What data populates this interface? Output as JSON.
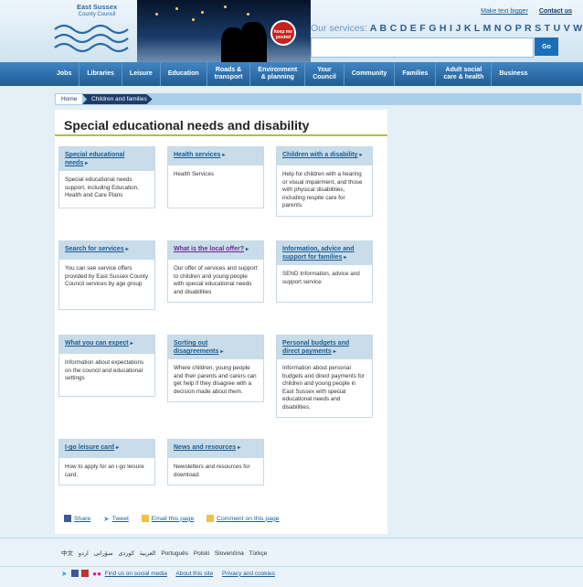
{
  "header": {
    "logo_line1": "East Sussex",
    "logo_line2": "County Council",
    "banner_sign": "keep me posted",
    "text_blogger": "Make text bigger",
    "contact": "Contact us",
    "services_label": "Our services:",
    "services_letters": "A B C D E F G H I J K L M N O P R S T U V W Y Z",
    "search_placeholder": "",
    "go": "Go"
  },
  "nav": [
    "Jobs",
    "Libraries",
    "Leisure",
    "Education",
    "Roads &\ntransport",
    "Environment\n& planning",
    "Your\nCouncil",
    "Community",
    "Families",
    "Adult social\ncare & health",
    "Business"
  ],
  "breadcrumb": {
    "home": "Home",
    "current": "Children and families"
  },
  "page_title": "Special educational needs and disability",
  "cards": [
    {
      "title": "Special educational needs",
      "body": "Special educational needs support, including Education, Health and Care Plans"
    },
    {
      "title": "Health services",
      "body": "Health Services"
    },
    {
      "title": "Children with a disability",
      "body": "Help for children with a hearing or visual impairment, and those with physical disabilities, including respite care for parents."
    },
    {
      "title": "Search for services",
      "body": "You can see service offers provided by East Sussex County Council services by age group"
    },
    {
      "title": "What is the local offer?",
      "body": "Our offer of services and support to children and young people with special educational needs and disabilities"
    },
    {
      "title": "Information, advice and support for families",
      "body": "SEND Information, advice and support service"
    },
    {
      "title": "What you can expect",
      "body": "Information about expectations on the council and educational settings"
    },
    {
      "title": "Sorting out disagreements",
      "body": "Where children, young people and their parents and carers can get help if they disagree with a decision made about them."
    },
    {
      "title": "Personal budgets and direct payments",
      "body": "Information about personal budgets and direct payments for children and young people in East Sussex with special educational needs and disabilities."
    },
    {
      "title": "I-go leisure card",
      "body": "How to apply for an i-go leisure card."
    },
    {
      "title": "News and resources",
      "body": "Newsletters and resources for download."
    }
  ],
  "share": {
    "share": "Share",
    "tweet": "Tweet",
    "email": "Email this page",
    "comment": "Comment on this page"
  },
  "footer": {
    "languages": "中文 العربية کوردی سۆرانی اردو Português Polski Slovenčina Türkçe",
    "social": "Find us on social media",
    "about": "About this site",
    "privacy": "Privacy and cookies"
  },
  "colors": {
    "nav": "#225c94",
    "accent_rule": "#b2c234",
    "card_head": "#c9dce9",
    "link": "#1a5c93",
    "visited": "#6a2c91"
  }
}
